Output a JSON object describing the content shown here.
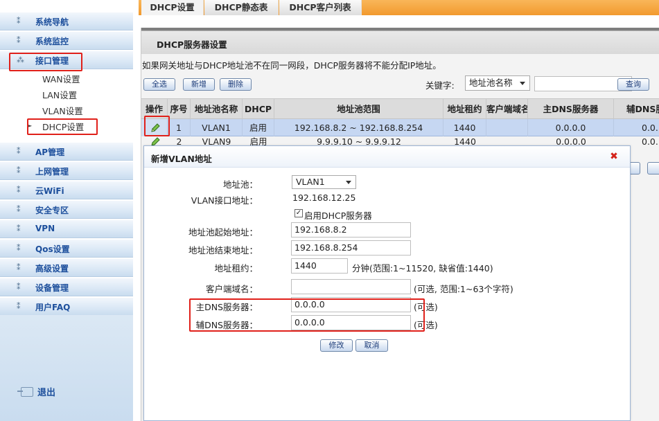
{
  "sidebar": {
    "menu": [
      {
        "label": "系统导航"
      },
      {
        "label": "系统监控"
      },
      {
        "label": "接口管理"
      },
      {
        "label": "AP管理"
      },
      {
        "label": "上网管理"
      },
      {
        "label": "云WiFi"
      },
      {
        "label": "安全专区"
      },
      {
        "label": "VPN"
      },
      {
        "label": "Qos设置"
      },
      {
        "label": "高级设置"
      },
      {
        "label": "设备管理"
      },
      {
        "label": "用户FAQ"
      }
    ],
    "submenu": [
      {
        "label": "WAN设置"
      },
      {
        "label": "LAN设置"
      },
      {
        "label": "VLAN设置"
      },
      {
        "label": "DHCP设置"
      }
    ],
    "logout": "退出"
  },
  "tabs": [
    {
      "label": "DHCP设置"
    },
    {
      "label": "DHCP静态表"
    },
    {
      "label": "DHCP客户列表"
    }
  ],
  "panel": {
    "title": "DHCP服务器设置",
    "notice": "如果网关地址与DHCP地址池不在同一网段，DHCP服务器将不能分配IP地址。",
    "buttons": {
      "select_all": "全选",
      "add": "新增",
      "delete": "删除",
      "search": "查询"
    },
    "keyword_label": "关键字:",
    "keyword_field": "地址池名称",
    "search_value": ""
  },
  "table": {
    "columns": [
      "操作",
      "序号",
      "地址池名称",
      "DHCP",
      "地址池范围",
      "地址租约",
      "客户端域名",
      "主DNS服务器",
      "辅DNS服"
    ],
    "rows": [
      {
        "index": "1",
        "pool": "VLAN1",
        "dhcp": "启用",
        "range": "192.168.8.2 ~ 192.168.8.254",
        "lease": "1440",
        "domain": "",
        "dns1": "0.0.0.0",
        "dns2": "0.0."
      },
      {
        "index": "2",
        "pool": "VLAN9",
        "dhcp": "启用",
        "range": "9.9.9.10 ~ 9.9.9.12",
        "lease": "1440",
        "domain": "",
        "dns1": "0.0.0.0",
        "dns2": "0.0."
      }
    ]
  },
  "dialog": {
    "title": "新增VLAN地址",
    "fields": {
      "pool_label": "地址池：",
      "pool_value": "VLAN1",
      "vlan_ip_label": "VLAN接口地址：",
      "vlan_ip_value": "192.168.12.25",
      "enable_dhcp_label": "启用DHCP服务器",
      "enable_dhcp_checked": true,
      "start_label": "地址池起始地址：",
      "start_value": "192.168.8.2",
      "end_label": "地址池结束地址：",
      "end_value": "192.168.8.254",
      "lease_label": "地址租约：",
      "lease_value": "1440",
      "lease_hint": "分钟(范围:1~11520, 缺省值:1440)",
      "domain_label": "客户端域名：",
      "domain_value": "",
      "domain_hint": "(可选, 范围:1~63个字符)",
      "dns1_label": "主DNS服务器：",
      "dns1_value": "0.0.0.0",
      "dns1_hint": "(可选)",
      "dns2_label": "辅DNS服务器：",
      "dns2_value": "0.0.0.0",
      "dns2_hint": "(可选)"
    },
    "buttons": {
      "modify": "修改",
      "cancel": "取消"
    }
  },
  "colors": {
    "highlight": "#e0201a",
    "accent_orange": "#f29a2e",
    "selected_row": "#c6d7f2",
    "menu_text": "#1d4f9c"
  },
  "icons": {
    "close": "close-icon",
    "edit": "edit-pencil-icon",
    "logout": "logout-icon"
  }
}
